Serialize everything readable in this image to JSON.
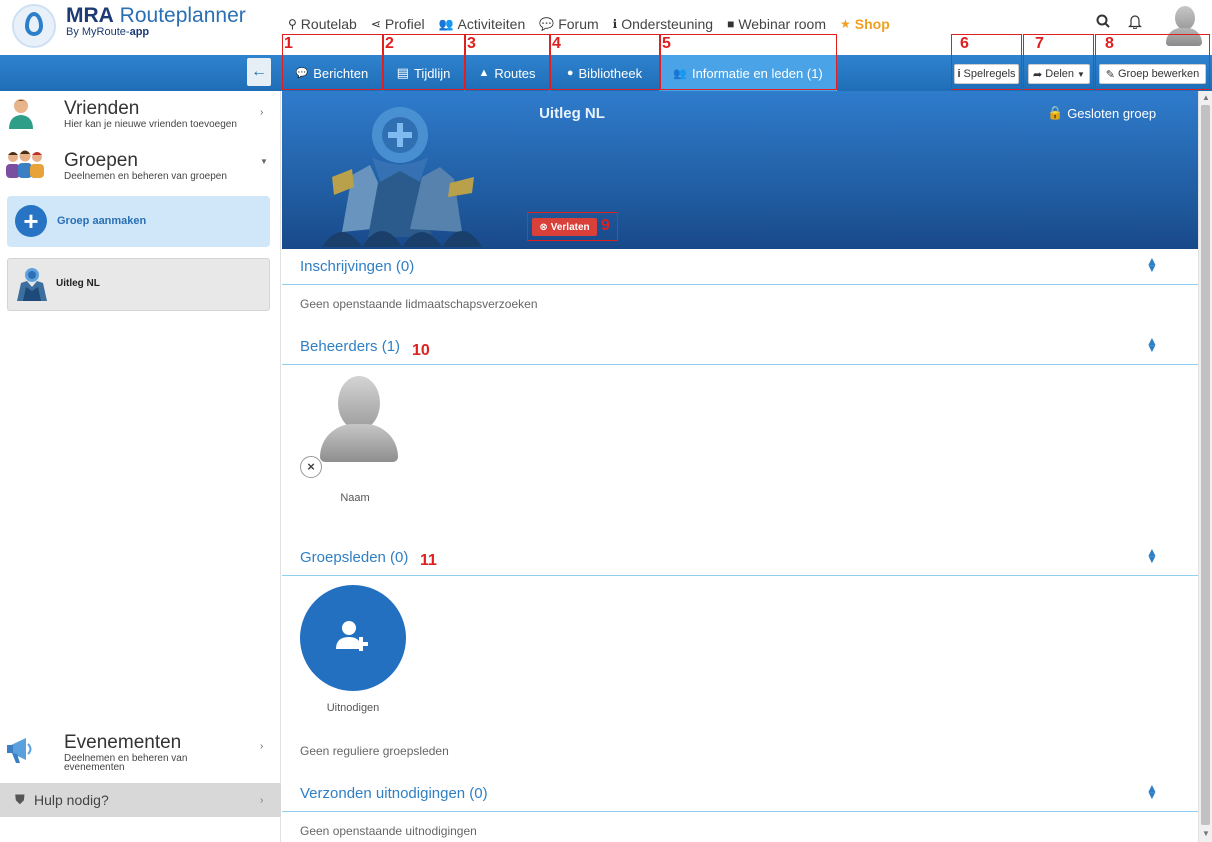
{
  "logo": {
    "brand": "MRA",
    "name": "Routeplanner",
    "by": "By MyRoute-",
    "by_bold": "app"
  },
  "topnav": [
    {
      "label": "Routelab",
      "icon": "map-marker-icon",
      "glyph": "⚲"
    },
    {
      "label": "Profiel",
      "icon": "share-icon",
      "glyph": "⋖"
    },
    {
      "label": "Activiteiten",
      "icon": "users-icon",
      "glyph": "👥"
    },
    {
      "label": "Forum",
      "icon": "comments-icon",
      "glyph": "💬"
    },
    {
      "label": "Ondersteuning",
      "icon": "info-icon",
      "glyph": "ℹ"
    },
    {
      "label": "Webinar room",
      "icon": "video-icon",
      "glyph": "■"
    },
    {
      "label": "Shop",
      "icon": "star-icon",
      "glyph": "★"
    }
  ],
  "tabs": [
    {
      "label": "Berichten",
      "glyph": "💬"
    },
    {
      "label": "Tijdlijn",
      "glyph": "▤"
    },
    {
      "label": "Routes",
      "glyph": "▲"
    },
    {
      "label": "Bibliotheek",
      "glyph": "●"
    },
    {
      "label": "Informatie en leden (1)",
      "glyph": "👥"
    }
  ],
  "actions": {
    "rules": "Spelregels",
    "share": "Delen",
    "edit": "Groep bewerken"
  },
  "annotations": [
    "1",
    "2",
    "3",
    "4",
    "5",
    "6",
    "7",
    "8",
    "9",
    "10",
    "11"
  ],
  "sidebar": {
    "friends": {
      "title": "Vrienden",
      "sub": "Hier kan je nieuwe vrienden toevoegen"
    },
    "groups": {
      "title": "Groepen",
      "sub": "Deelnemen en beheren van groepen"
    },
    "create": "Groep aanmaken",
    "group_item": "Uitleg NL",
    "events": {
      "title": "Evenementen",
      "sub1": "Deelnemen en beheren van",
      "sub2": "evenementen"
    },
    "help": "Hulp nodig?"
  },
  "group": {
    "title": "Uitleg NL",
    "closed": "Gesloten groep",
    "leave": "Verlaten"
  },
  "sections": {
    "registrations": {
      "title": "Inschrijvingen (0)",
      "empty": "Geen openstaande lidmaatschapsverzoeken"
    },
    "admins": {
      "title": "Beheerders (1)",
      "member_name": "Naam"
    },
    "members": {
      "title": "Groepsleden (0)",
      "invite": "Uitnodigen",
      "empty": "Geen reguliere groepsleden"
    },
    "invitations": {
      "title": "Verzonden uitnodigingen (0)",
      "empty": "Geen openstaande uitnodigingen"
    }
  },
  "colors": {
    "primary": "#1f6db7",
    "active_tab": "#4aa3e6",
    "danger": "#d9403a",
    "shop": "#f0a020",
    "annotation": "#e02020"
  }
}
